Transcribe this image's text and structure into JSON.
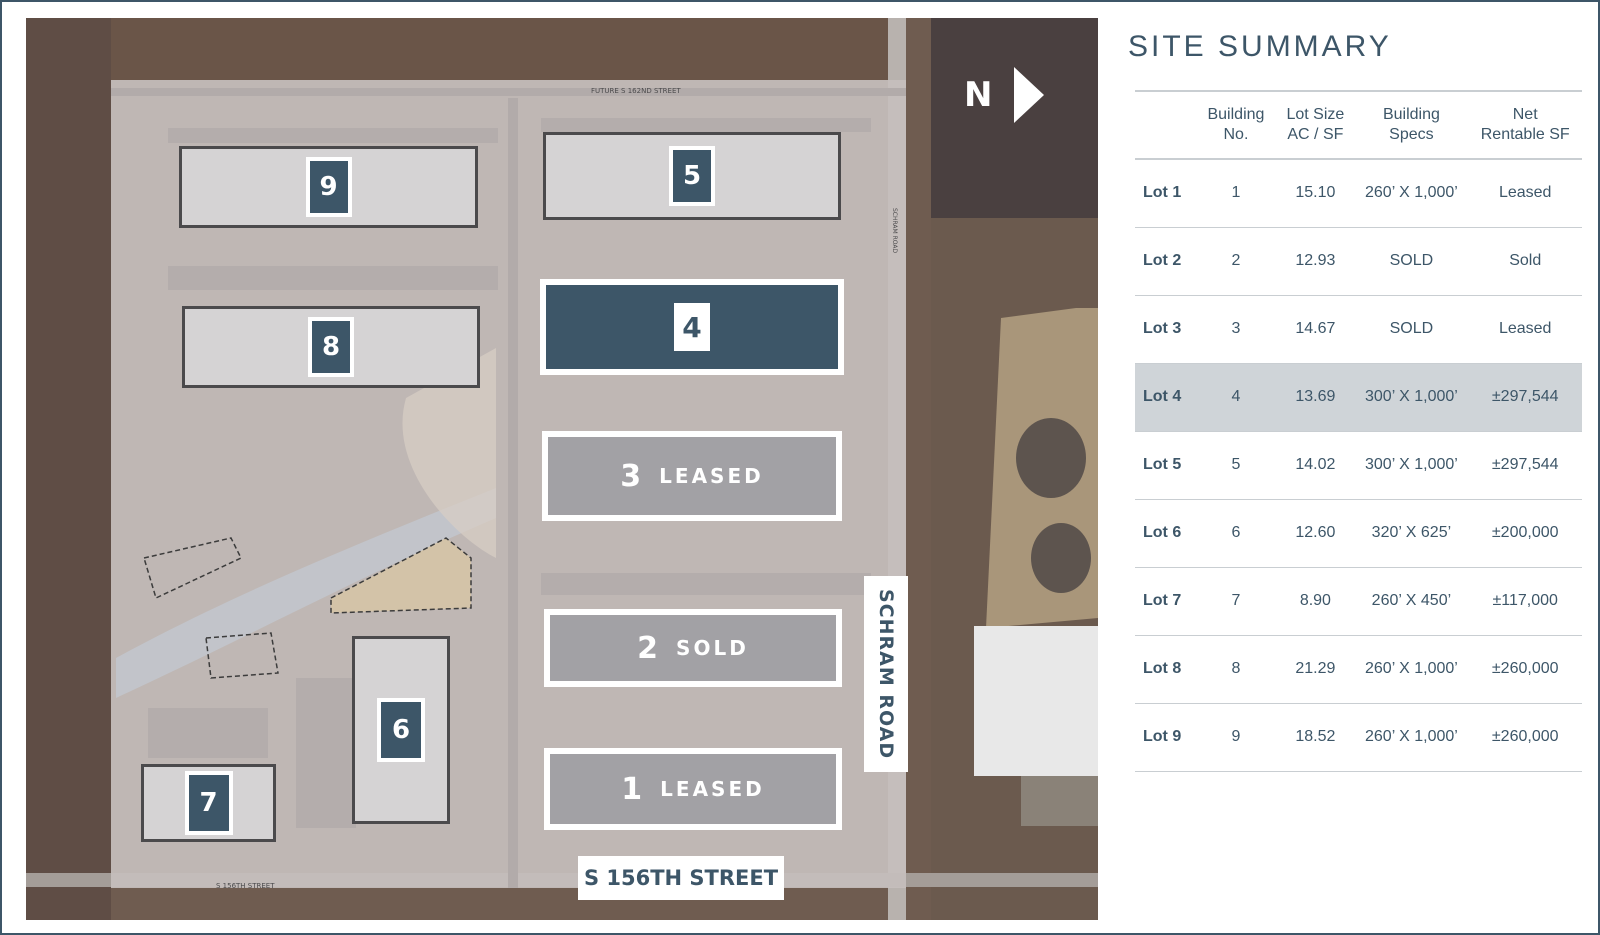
{
  "summary": {
    "title": "SITE SUMMARY",
    "headers": {
      "lot": "",
      "building": [
        "Building",
        "No."
      ],
      "lot_size": [
        "Lot Size",
        "AC / SF"
      ],
      "specs": [
        "Building",
        "Specs"
      ],
      "net": [
        "Net",
        "Rentable SF"
      ]
    },
    "rows": [
      {
        "lot": "Lot 1",
        "building": "1",
        "size": "15.10",
        "specs": "260’ X 1,000’",
        "net": "Leased",
        "highlight": false
      },
      {
        "lot": "Lot 2",
        "building": "2",
        "size": "12.93",
        "specs": "SOLD",
        "net": "Sold",
        "highlight": false
      },
      {
        "lot": "Lot 3",
        "building": "3",
        "size": "14.67",
        "specs": "SOLD",
        "net": "Leased",
        "highlight": false
      },
      {
        "lot": "Lot 4",
        "building": "4",
        "size": "13.69",
        "specs": "300’ X 1,000’",
        "net": "±297,544",
        "highlight": true
      },
      {
        "lot": "Lot 5",
        "building": "5",
        "size": "14.02",
        "specs": "300’ X 1,000’",
        "net": "±297,544",
        "highlight": false
      },
      {
        "lot": "Lot 6",
        "building": "6",
        "size": "12.60",
        "specs": "320’ X 625’",
        "net": "±200,000",
        "highlight": false
      },
      {
        "lot": "Lot 7",
        "building": "7",
        "size": "8.90",
        "specs": "260’ X 450’",
        "net": "±117,000",
        "highlight": false
      },
      {
        "lot": "Lot 8",
        "building": "8",
        "size": "21.29",
        "specs": "260’ X 1,000’",
        "net": "±260,000",
        "highlight": false
      },
      {
        "lot": "Lot 9",
        "building": "9",
        "size": "18.52",
        "specs": "260’ X 1,000’",
        "net": "±260,000",
        "highlight": false
      }
    ]
  },
  "map": {
    "compass": "N",
    "roads": {
      "east": "SCHRAM ROAD",
      "south": "S 156TH STREET",
      "north_small": "FUTURE S 162ND STREET",
      "south_small": "S 156TH STREET",
      "east_small": "SCHRAM ROAD"
    },
    "buildings": {
      "b1": {
        "number": "1",
        "status": "LEASED"
      },
      "b2": {
        "number": "2",
        "status": "SOLD"
      },
      "b3": {
        "number": "3",
        "status": "LEASED"
      },
      "b4": {
        "number": "4"
      },
      "b5": {
        "number": "5"
      },
      "b6": {
        "number": "6"
      },
      "b7": {
        "number": "7"
      },
      "b8": {
        "number": "8"
      },
      "b9": {
        "number": "9"
      }
    }
  }
}
